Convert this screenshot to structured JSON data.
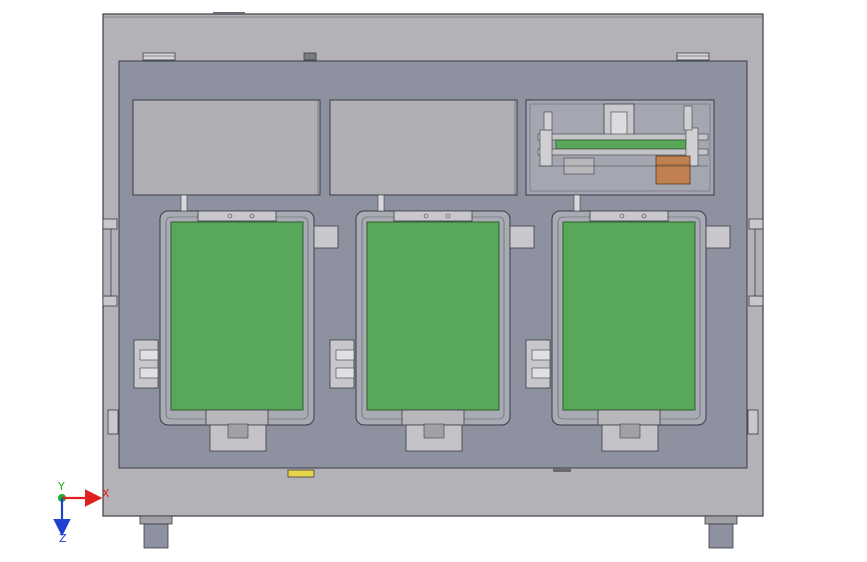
{
  "viewport": {
    "background": "#ffffff"
  },
  "machine": {
    "frame_color": "#b3b3b7",
    "panel_color": "#8d91a0",
    "edge_color": "#3c3c44",
    "pcb_color": "#59a85a",
    "stations": 3,
    "top_modules": [
      {
        "name": "top-module-left",
        "kind": "cover"
      },
      {
        "name": "top-module-middle",
        "kind": "cover"
      },
      {
        "name": "top-module-right",
        "kind": "mechanism"
      }
    ]
  },
  "axis_triad": {
    "x_label": "X",
    "y_label": "Y",
    "z_label": "Z",
    "x_color": "#e02020",
    "y_color": "#20b020",
    "z_color": "#2040d0"
  }
}
